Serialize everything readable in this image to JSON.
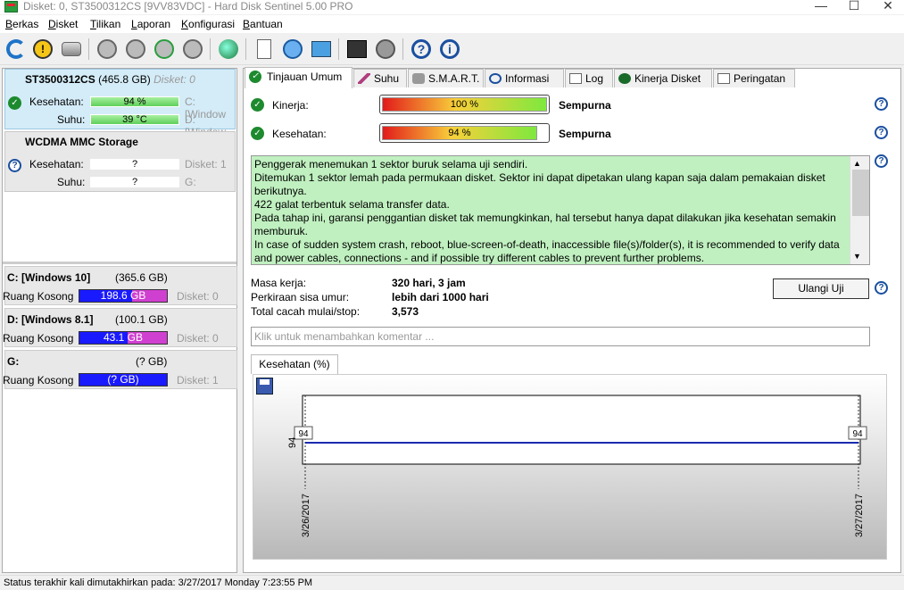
{
  "window": {
    "title": "Disket: 0, ST3500312CS [9VV83VDC]  -  Hard Disk Sentinel 5.00 PRO",
    "minimize": "—",
    "maximize": "☐",
    "close": "✕"
  },
  "menu": [
    "Berkas",
    "Disket",
    "Tilikan",
    "Laporan",
    "Konfigurasi",
    "Bantuan"
  ],
  "disks": [
    {
      "name": "ST3500312CS",
      "size": "(465.8 GB)",
      "disk": "Disket: 0",
      "health_label": "Kesehatan:",
      "health": "94 %",
      "health_pct": 94,
      "temp_label": "Suhu:",
      "temp": "39 °C",
      "side1": "C: [Window",
      "side2": "D: [Window"
    },
    {
      "name": "WCDMA   MMC Storage",
      "health_label": "Kesehatan:",
      "health": "?",
      "temp_label": "Suhu:",
      "temp": "?",
      "side1": "Disket: 1",
      "side2": "G:"
    }
  ],
  "volumes": [
    {
      "name": "C: [Windows 10]",
      "size": "(365.6 GB)",
      "free_label": "Ruang Kosong",
      "free": "198.6 GB",
      "disk": "Disket: 0"
    },
    {
      "name": "D: [Windows 8.1]",
      "size": "(100.1 GB)",
      "free_label": "Ruang Kosong",
      "free": "43.1 GB",
      "disk": "Disket: 0"
    },
    {
      "name": "G:",
      "size": "(? GB)",
      "free_label": "Ruang Kosong",
      "free": "(? GB)",
      "disk": "Disket: 1"
    }
  ],
  "tabs": [
    "Tinjauan Umum",
    "Suhu",
    "S.M.A.R.T.",
    "Informasi",
    "Log",
    "Kinerja Disket",
    "Peringatan"
  ],
  "overview": {
    "perf_label": "Kinerja:",
    "perf_value": "100 %",
    "perf_pct": 100,
    "perf_text": "Sempurna",
    "health_label": "Kesehatan:",
    "health_value": "94 %",
    "health_pct": 94,
    "health_text": "Sempurna",
    "message": [
      "Penggerak menemukan 1 sektor buruk selama uji sendiri.",
      "Ditemukan 1 sektor lemah pada permukaan disket. Sektor ini dapat dipetakan ulang kapan saja dalam pemakaian disket berikutnya.",
      "422 galat terbentuk selama transfer data.",
      "Pada tahap ini, garansi penggantian disket tak memungkinkan, hal tersebut hanya dapat dilakukan jika kesehatan semakin memburuk.",
      "In case of sudden system crash, reboot, blue-screen-of-death, inaccessible file(s)/folder(s), it is recommended to verify data and power cables, connections - and if possible try different cables to prevent further problems."
    ],
    "stats": [
      {
        "label": "Masa kerja:",
        "value": "320 hari, 3 jam"
      },
      {
        "label": "Perkiraan sisa umur:",
        "value": "lebih dari 1000 hari"
      },
      {
        "label": "Total cacah mulai/stop:",
        "value": "3,573"
      }
    ],
    "retest_button": "Ulangi Uji",
    "comment_placeholder": "Klik untuk menambahkan komentar ..."
  },
  "chart_data": {
    "type": "line",
    "title": "Kesehatan (%)",
    "x": [
      "3/26/2017",
      "3/27/2017"
    ],
    "series": [
      {
        "values": [
          94,
          94
        ]
      }
    ],
    "ylabel": "94",
    "point_labels": [
      "94",
      "94"
    ]
  },
  "status": "Status terakhir kali dimutakhirkan pada: 3/27/2017 Monday 7:23:55 PM"
}
